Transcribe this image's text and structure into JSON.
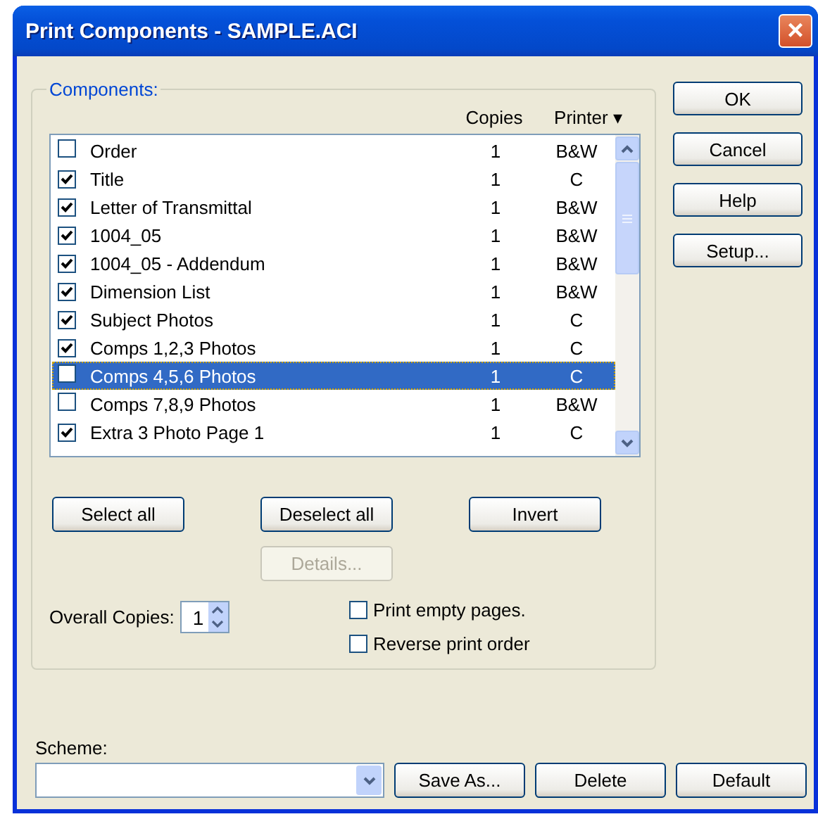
{
  "window": {
    "title": "Print Components - SAMPLE.ACI",
    "close": "×"
  },
  "components": {
    "label": "Components:",
    "columns": [
      "Copies",
      "Printer ▾"
    ],
    "rows": [
      {
        "name": "Order",
        "copies": "1",
        "printer": "B&W",
        "checked": false,
        "selected": false
      },
      {
        "name": "Title",
        "copies": "1",
        "printer": "C",
        "checked": true,
        "selected": false
      },
      {
        "name": "Letter of Transmittal",
        "copies": "1",
        "printer": "B&W",
        "checked": true,
        "selected": false
      },
      {
        "name": "1004_05",
        "copies": "1",
        "printer": "B&W",
        "checked": true,
        "selected": false
      },
      {
        "name": "1004_05 - Addendum",
        "copies": "1",
        "printer": "B&W",
        "checked": true,
        "selected": false
      },
      {
        "name": "Dimension List",
        "copies": "1",
        "printer": "B&W",
        "checked": true,
        "selected": false
      },
      {
        "name": "Subject Photos",
        "copies": "1",
        "printer": "C",
        "checked": true,
        "selected": false
      },
      {
        "name": "Comps 1,2,3 Photos",
        "copies": "1",
        "printer": "C",
        "checked": true,
        "selected": false
      },
      {
        "name": "Comps 4,5,6 Photos",
        "copies": "1",
        "printer": "C",
        "checked": false,
        "selected": true
      },
      {
        "name": "Comps 7,8,9 Photos",
        "copies": "1",
        "printer": "B&W",
        "checked": false,
        "selected": false
      },
      {
        "name": "Extra 3 Photo Page 1",
        "copies": "1",
        "printer": "C",
        "checked": true,
        "selected": false
      }
    ],
    "buttons": [
      {
        "label": "Select all",
        "disabled": false
      },
      {
        "label": "Deselect all",
        "disabled": false
      },
      {
        "label": "Invert",
        "disabled": false
      },
      {
        "label": "Details...",
        "disabled": true
      }
    ],
    "overall_copies": {
      "label": "Overall Copies:",
      "value": "1"
    },
    "options": [
      {
        "label": "Print empty pages.",
        "checked": false
      },
      {
        "label": "Reverse print order",
        "checked": false
      }
    ]
  },
  "side_buttons": [
    "OK",
    "Cancel",
    "Help",
    "Setup..."
  ],
  "scheme": {
    "label": "Scheme:",
    "buttons": [
      "Save As...",
      "Delete",
      "Default"
    ]
  }
}
